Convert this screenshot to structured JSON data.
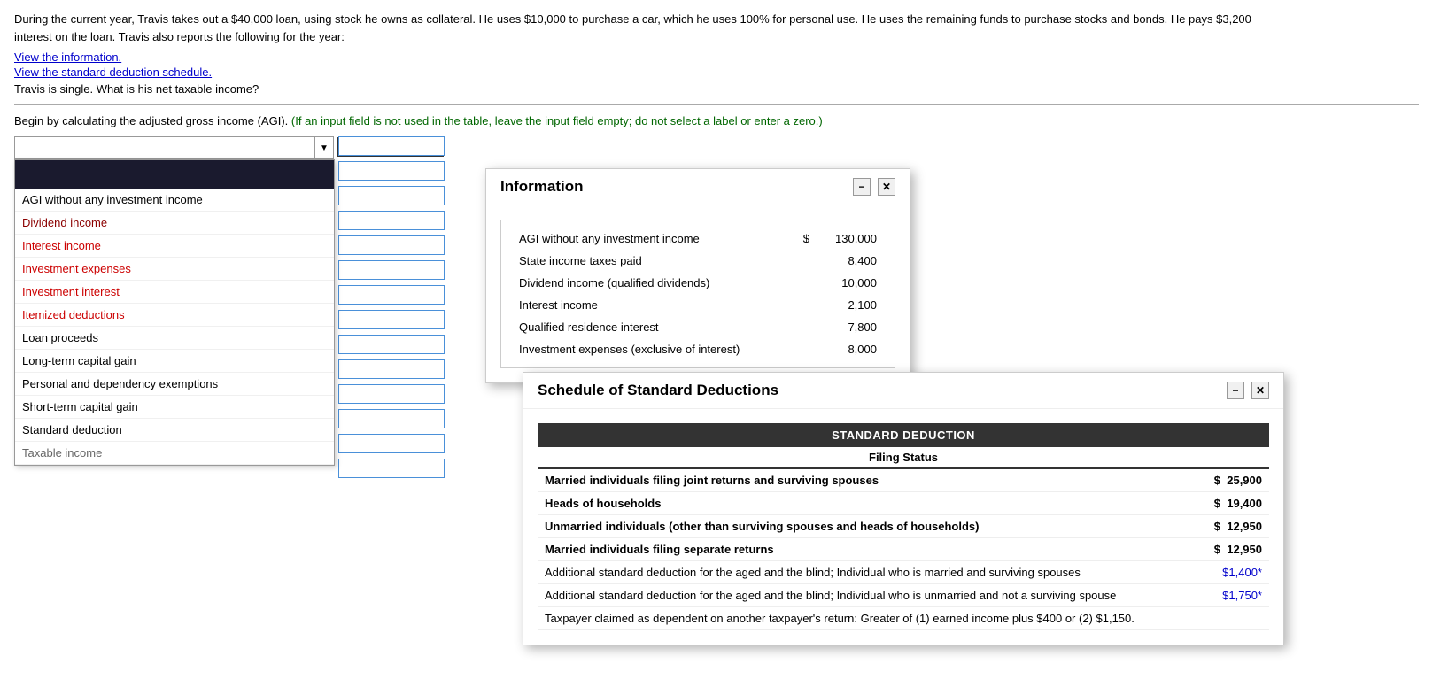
{
  "problem": {
    "text": "During the current year, Travis takes out a $40,000 loan, using stock he owns as collateral. He uses $10,000 to purchase a car, which he uses 100% for personal use. He uses the remaining funds to purchase stocks and bonds. He pays $3,200 interest on the loan. Travis also reports the following for the year:",
    "link1": "View the information.",
    "link2": "View the standard deduction schedule.",
    "question": "Travis is single. What is his net taxable income?"
  },
  "instructions": {
    "main": "Begin by calculating the adjusted gross income (AGI).",
    "note": "(If an input field is not used in the table, leave the input field empty; do not select a label or enter a zero.)"
  },
  "dropdown": {
    "placeholder": "",
    "items": [
      {
        "id": "agi_no_invest",
        "label": "AGI without any investment income",
        "color": "black"
      },
      {
        "id": "dividend",
        "label": "Dividend income",
        "color": "dark-red"
      },
      {
        "id": "interest",
        "label": "Interest income",
        "color": "red"
      },
      {
        "id": "invest_exp",
        "label": "Investment expenses",
        "color": "red"
      },
      {
        "id": "invest_interest",
        "label": "Investment interest",
        "color": "red"
      },
      {
        "id": "itemized",
        "label": "Itemized deductions",
        "color": "red"
      },
      {
        "id": "loan",
        "label": "Loan proceeds",
        "color": "black"
      },
      {
        "id": "ltcg",
        "label": "Long-term capital gain",
        "color": "black"
      },
      {
        "id": "personal_dep",
        "label": "Personal and dependency exemptions",
        "color": "black"
      },
      {
        "id": "short_term",
        "label": "Short-term capital gain",
        "color": "black"
      },
      {
        "id": "standard",
        "label": "Standard deduction",
        "color": "black"
      },
      {
        "id": "taxable",
        "label": "Taxable income",
        "color": "black"
      }
    ]
  },
  "info_popup": {
    "title": "Information",
    "rows": [
      {
        "label": "AGI without any investment income",
        "dollar": "$",
        "value": "130,000"
      },
      {
        "label": "State income taxes paid",
        "dollar": "",
        "value": "8,400"
      },
      {
        "label": "Dividend income (qualified dividends)",
        "dollar": "",
        "value": "10,000"
      },
      {
        "label": "Interest income",
        "dollar": "",
        "value": "2,100"
      },
      {
        "label": "Qualified residence interest",
        "dollar": "",
        "value": "7,800"
      },
      {
        "label": "Investment expenses (exclusive of interest)",
        "dollar": "",
        "value": "8,000"
      }
    ]
  },
  "schedule_popup": {
    "title": "Schedule of Standard Deductions",
    "table_header": "STANDARD DEDUCTION",
    "subheader": "Filing Status",
    "rows": [
      {
        "label": "Married individuals filing joint returns and surviving spouses",
        "dollar": "$",
        "value": "25,900",
        "bold": true,
        "blue": false
      },
      {
        "label": "Heads of households",
        "dollar": "$",
        "value": "19,400",
        "bold": true,
        "blue": false
      },
      {
        "label": "Unmarried individuals (other than surviving spouses and heads of households)",
        "dollar": "$",
        "value": "12,950",
        "bold": true,
        "blue": false
      },
      {
        "label": "Married individuals filing separate returns",
        "dollar": "$",
        "value": "12,950",
        "bold": true,
        "blue": false
      },
      {
        "label": "Additional standard deduction for the aged and the blind; Individual who is married and surviving spouses",
        "dollar": "",
        "value": "$1,400*",
        "bold": false,
        "blue": true
      },
      {
        "label": "Additional standard deduction for the aged and the blind; Individual who is unmarried and not a surviving spouse",
        "dollar": "",
        "value": "$1,750*",
        "bold": false,
        "blue": true
      },
      {
        "label": "Taxpayer claimed as dependent on another taxpayer's return: Greater of (1) earned income plus $400 or (2) $1,150.",
        "dollar": "",
        "value": "",
        "bold": false,
        "blue": false
      }
    ]
  },
  "inputs": {
    "count": 14
  },
  "colors": {
    "accent_blue": "#4a90d9",
    "dark_header": "#1a1a2e",
    "link_blue": "#0000cc",
    "red": "#cc0000",
    "dark_red": "#8b0000"
  }
}
